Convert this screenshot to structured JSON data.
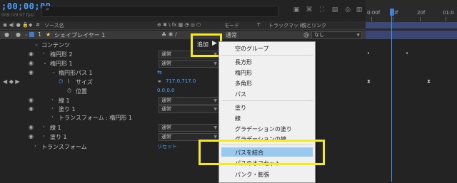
{
  "header": {
    "timecode": ";00;00;09",
    "fps": "009 (29.97 fps)",
    "search_placeholder": "",
    "search_icon": "search-icon"
  },
  "columns": {
    "source_name": "ソース名",
    "mode": "モード",
    "t": "T",
    "track_matte": "トラックマット",
    "parent_link": "親とリンク"
  },
  "ruler": {
    "labels": [
      "0:00f",
      "10f",
      "20f",
      "01:0"
    ]
  },
  "layer": {
    "number": "1",
    "star": "★",
    "name": "シェイプレイヤー 1",
    "mode": "通常",
    "parent": "なし"
  },
  "rows": [
    {
      "label": "コンテンツ"
    },
    {
      "label": "楕円形 2",
      "mode": "通常"
    },
    {
      "label": "楕円形 1",
      "mode": "通常"
    },
    {
      "label": "楕円形パス 1"
    },
    {
      "label": "サイズ",
      "value": "717.0,717.0"
    },
    {
      "label": "位置",
      "value": "0.0,0.0"
    },
    {
      "label": "線 1",
      "mode": "通常"
    },
    {
      "label": "塗り 1",
      "mode": "通常"
    },
    {
      "label": "トランスフォーム : 楕円形 1"
    },
    {
      "label": "線 1",
      "mode": "通常"
    },
    {
      "label": "塗り 1",
      "mode": "通常"
    },
    {
      "label": "トランスフォーム",
      "value": "リセット"
    }
  ],
  "add_button": {
    "label": "追加"
  },
  "menu": {
    "items": [
      "空のグループ",
      "長方形",
      "楕円形",
      "多角形",
      "パス",
      "塗り",
      "線",
      "グラデーションの塗り",
      "グラデーションの線",
      "パスを結合",
      "パスのオフセット",
      "パンク・膨張"
    ],
    "highlighted": "パスを結合"
  },
  "colors": {
    "accent_blue": "#4aa3ff",
    "highlight_yellow": "#f4e928",
    "menu_highlight": "#99c9ef"
  }
}
